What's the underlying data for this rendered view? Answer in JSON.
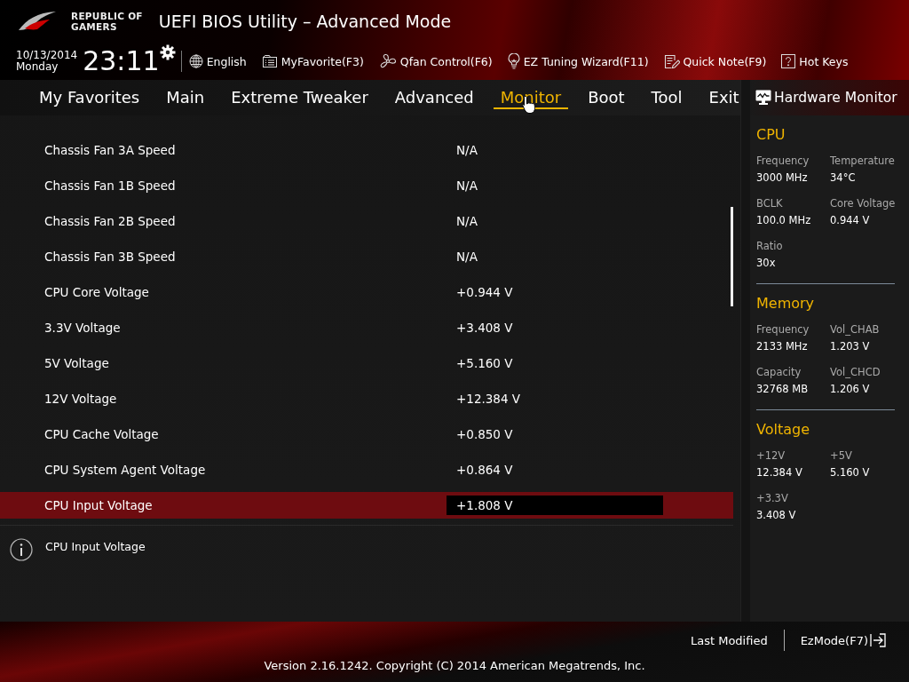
{
  "header": {
    "brand": [
      "REPUBLIC OF",
      "GAMERS"
    ],
    "title": "UEFI BIOS Utility – Advanced Mode",
    "date": "10/13/2014",
    "day": "Monday",
    "time": "23:11"
  },
  "toolbar": [
    {
      "kind": "globe",
      "label": "English"
    },
    {
      "kind": "favorite",
      "label": "MyFavorite(F3)"
    },
    {
      "kind": "fan",
      "label": "Qfan Control(F6)"
    },
    {
      "kind": "bulb",
      "label": "EZ Tuning Wizard(F11)"
    },
    {
      "kind": "note",
      "label": "Quick Note(F9)"
    },
    {
      "kind": "help",
      "label": "Hot Keys"
    }
  ],
  "tabs": [
    {
      "label": "My Favorites",
      "selected": false
    },
    {
      "label": "Main",
      "selected": false
    },
    {
      "label": "Extreme Tweaker",
      "selected": false
    },
    {
      "label": "Advanced",
      "selected": false
    },
    {
      "label": "Monitor",
      "selected": true
    },
    {
      "label": "Boot",
      "selected": false
    },
    {
      "label": "Tool",
      "selected": false
    },
    {
      "label": "Exit",
      "selected": false
    }
  ],
  "settings": [
    {
      "label": "Chassis Fan 3A Speed",
      "value": "N/A",
      "selected": false
    },
    {
      "label": "Chassis Fan 1B Speed",
      "value": "N/A",
      "selected": false
    },
    {
      "label": "Chassis Fan 2B Speed",
      "value": "N/A",
      "selected": false
    },
    {
      "label": "Chassis Fan 3B Speed",
      "value": "N/A",
      "selected": false
    },
    {
      "label": "CPU Core Voltage",
      "value": "+0.944 V",
      "selected": false
    },
    {
      "label": "3.3V Voltage",
      "value": "+3.408 V",
      "selected": false
    },
    {
      "label": "5V Voltage",
      "value": "+5.160 V",
      "selected": false
    },
    {
      "label": "12V Voltage",
      "value": "+12.384 V",
      "selected": false
    },
    {
      "label": "CPU Cache Voltage",
      "value": "+0.850 V",
      "selected": false
    },
    {
      "label": "CPU System Agent Voltage",
      "value": "+0.864 V",
      "selected": false
    },
    {
      "label": "CPU Input Voltage",
      "value": "+1.808 V",
      "selected": true
    }
  ],
  "help_text": "CPU Input Voltage",
  "hardware_monitor": {
    "title": "Hardware Monitor",
    "sections": [
      {
        "title": "CPU",
        "items": [
          {
            "label": "Frequency",
            "value": "3000 MHz"
          },
          {
            "label": "Temperature",
            "value": "34°C"
          },
          {
            "label": "BCLK",
            "value": "100.0 MHz"
          },
          {
            "label": "Core Voltage",
            "value": "0.944 V"
          },
          {
            "label": "Ratio",
            "value": "30x"
          }
        ]
      },
      {
        "title": "Memory",
        "items": [
          {
            "label": "Frequency",
            "value": "2133 MHz"
          },
          {
            "label": "Vol_CHAB",
            "value": "1.203 V"
          },
          {
            "label": "Capacity",
            "value": "32768 MB"
          },
          {
            "label": "Vol_CHCD",
            "value": "1.206 V"
          }
        ]
      },
      {
        "title": "Voltage",
        "items": [
          {
            "label": "+12V",
            "value": "12.384 V"
          },
          {
            "label": "+5V",
            "value": "5.160 V"
          },
          {
            "label": "+3.3V",
            "value": "3.408 V"
          }
        ]
      }
    ]
  },
  "footer": {
    "last_modified": "Last Modified",
    "ez_mode": "EzMode(F7)",
    "version": "Version 2.16.1242. Copyright (C) 2014 American Megatrends, Inc."
  }
}
